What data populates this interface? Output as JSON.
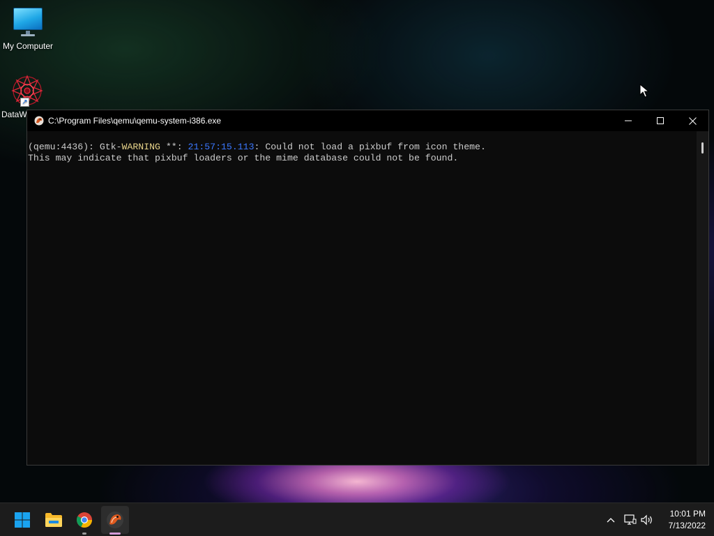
{
  "desktop": {
    "icons": [
      {
        "label": "My Computer",
        "icon": "monitor-icon"
      },
      {
        "label": "DataW",
        "icon": "datawarp-star-icon"
      }
    ]
  },
  "console": {
    "title": "C:\\Program Files\\qemu\\qemu-system-i386.exe",
    "lines": [
      {
        "prefix": "(qemu:4436): Gtk-",
        "level": "WARNING",
        "mid": " **: ",
        "timestamp": "21:57:15.113",
        "message": ": Could not load a pixbuf from icon theme."
      },
      {
        "text": "This may indicate that pixbuf loaders or the mime database could not be found."
      }
    ],
    "colors": {
      "background": "#0c0c0c",
      "text": "#cccccc",
      "timestamp": "#3b78ff",
      "level": "#e8d48a"
    }
  },
  "window_controls": {
    "minimize": "minimize-icon",
    "maximize": "maximize-icon",
    "close": "close-icon"
  },
  "taskbar": {
    "apps": [
      {
        "name": "Start",
        "icon": "windows-start-icon"
      },
      {
        "name": "File Explorer",
        "icon": "folder-icon"
      },
      {
        "name": "Google Chrome",
        "icon": "chrome-icon",
        "running": true
      },
      {
        "name": "QEMU",
        "icon": "qemu-icon",
        "active": true
      }
    ],
    "tray": {
      "chevron": "chevron-up-icon",
      "network": "network-icon",
      "volume": "volume-icon"
    },
    "clock": {
      "time": "10:01 PM",
      "date": "7/13/2022"
    }
  }
}
